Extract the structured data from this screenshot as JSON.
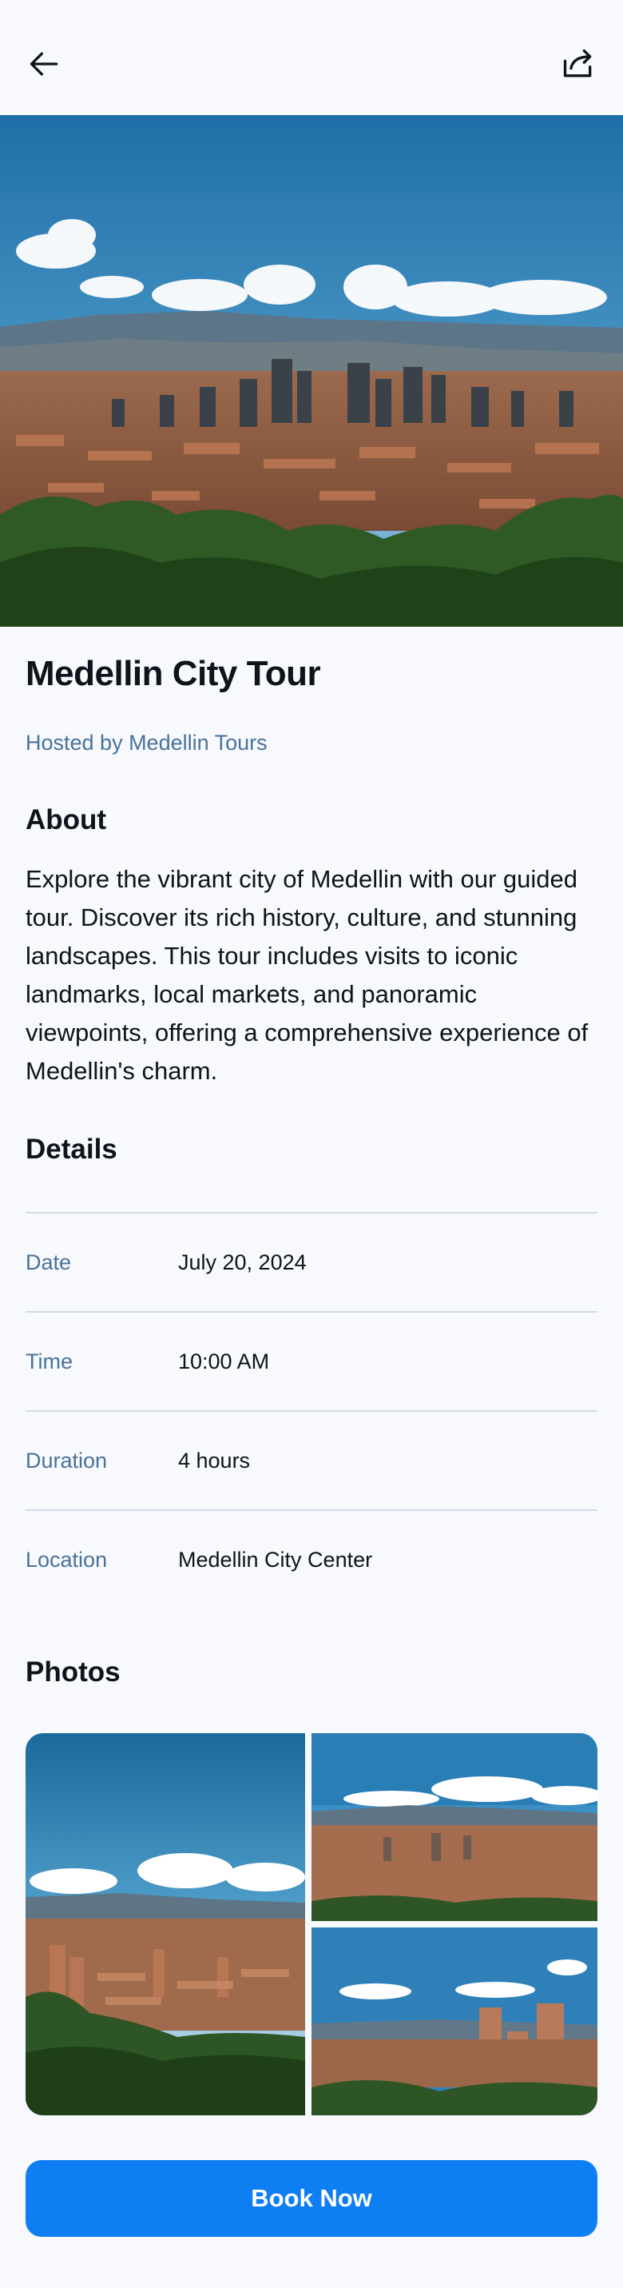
{
  "header": {
    "back_icon": "arrow-left-icon",
    "share_icon": "share-icon"
  },
  "tour": {
    "title": "Medellin City Tour",
    "host": "Hosted by Medellin Tours"
  },
  "about": {
    "heading": "About",
    "text": "Explore the vibrant city of Medellin with our guided tour. Discover its rich history, culture, and stunning landscapes. This tour includes visits to iconic landmarks, local markets, and panoramic viewpoints, offering a comprehensive experience of Medellin's charm."
  },
  "details": {
    "heading": "Details",
    "rows": [
      {
        "label": "Date",
        "value": "July 20, 2024"
      },
      {
        "label": "Time",
        "value": "10:00 AM"
      },
      {
        "label": "Duration",
        "value": "4 hours"
      },
      {
        "label": "Location",
        "value": "Medellin City Center"
      }
    ]
  },
  "photos": {
    "heading": "Photos"
  },
  "actions": {
    "book_label": "Book Now"
  },
  "colors": {
    "accent": "#0d7ff2",
    "muted_text": "#49729c",
    "divider": "#cfdbe8",
    "background": "#f7f9fc"
  }
}
